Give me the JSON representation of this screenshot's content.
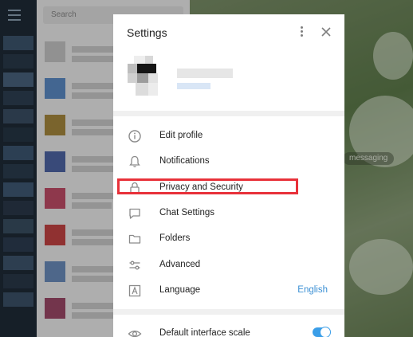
{
  "background": {
    "search": {
      "placeholder": "Search"
    },
    "messaging_pill": "messaging"
  },
  "dialog": {
    "title": "Settings",
    "menu_items": [
      {
        "label": "Edit profile",
        "icon": "info-icon"
      },
      {
        "label": "Notifications",
        "icon": "bell-icon"
      },
      {
        "label": "Privacy and Security",
        "icon": "lock-icon"
      },
      {
        "label": "Chat Settings",
        "icon": "chat-icon"
      },
      {
        "label": "Folders",
        "icon": "folder-icon"
      },
      {
        "label": "Advanced",
        "icon": "sliders-icon"
      },
      {
        "label": "Language",
        "icon": "language-icon",
        "value": "English"
      }
    ],
    "scale": {
      "label": "Default interface scale",
      "icon": "eye-icon",
      "enabled": true
    }
  },
  "colors": {
    "accent": "#3a8fd4",
    "highlight": "#e8313a"
  }
}
